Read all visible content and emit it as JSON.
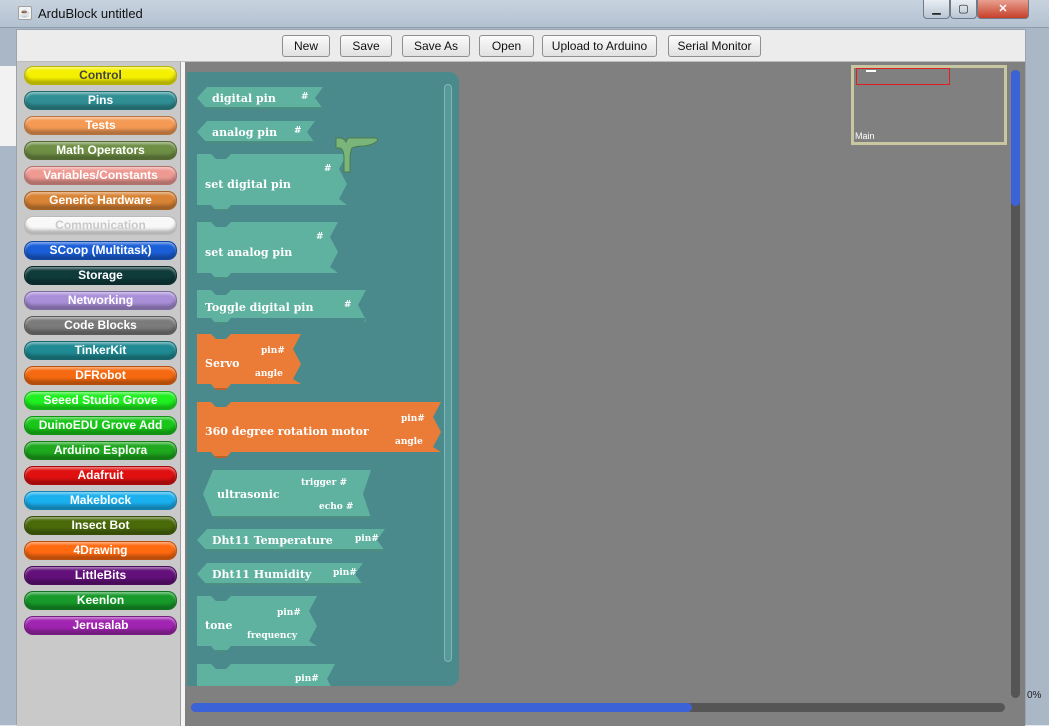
{
  "window": {
    "title": "ArduBlock untitled",
    "min": "▁",
    "max": "▢",
    "close": "✕",
    "app_icon": "☕"
  },
  "toolbar": {
    "new": "New",
    "save": "Save",
    "save_as": "Save As",
    "open": "Open",
    "upload": "Upload to Arduino",
    "serial": "Serial Monitor"
  },
  "categories": [
    {
      "label": "Control",
      "color": "#f5f000",
      "text": "#444"
    },
    {
      "label": "Pins",
      "color": "#2f8f95",
      "text": "#fff"
    },
    {
      "label": "Tests",
      "color": "#f59a55",
      "text": "#fff"
    },
    {
      "label": "Math Operators",
      "color": "#6f8f45",
      "text": "#fff"
    },
    {
      "label": "Variables/Constants",
      "color": "#ee9a93",
      "text": "#fff"
    },
    {
      "label": "Generic Hardware",
      "color": "#d98435",
      "text": "#fff"
    },
    {
      "label": "Communication",
      "color": "#f8f8f8",
      "text": "#c9c9c9"
    },
    {
      "label": "SCoop (Multitask)",
      "color": "#1a5fd8",
      "text": "#fff"
    },
    {
      "label": "Storage",
      "color": "#0f3b3b",
      "text": "#fff"
    },
    {
      "label": "Networking",
      "color": "#a98fd8",
      "text": "#fff"
    },
    {
      "label": "Code Blocks",
      "color": "#7b7b7b",
      "text": "#fff"
    },
    {
      "label": "TinkerKit",
      "color": "#1f8a93",
      "text": "#fff"
    },
    {
      "label": "DFRobot",
      "color": "#f56a10",
      "text": "#fff"
    },
    {
      "label": "Seeed Studio Grove",
      "color": "#1ff01f",
      "text": "#fff"
    },
    {
      "label": "DuinoEDU Grove Add",
      "color": "#19c719",
      "text": "#fff"
    },
    {
      "label": "Arduino Esplora",
      "color": "#1ea91e",
      "text": "#fff"
    },
    {
      "label": "Adafruit",
      "color": "#e01010",
      "text": "#fff"
    },
    {
      "label": "Makeblock",
      "color": "#1ab0ee",
      "text": "#fff"
    },
    {
      "label": "Insect Bot",
      "color": "#4a6a0a",
      "text": "#fff"
    },
    {
      "label": "4Drawing",
      "color": "#ff6a10",
      "text": "#fff"
    },
    {
      "label": "LittleBits",
      "color": "#63107a",
      "text": "#fff"
    },
    {
      "label": "Keenlon",
      "color": "#179a2a",
      "text": "#fff"
    },
    {
      "label": "Jerusalab",
      "color": "#a025b0",
      "text": "#fff"
    }
  ],
  "blocks": {
    "digital_pin": {
      "label": "digital pin",
      "socket": "#"
    },
    "analog_pin": {
      "label": "analog pin",
      "socket": "#"
    },
    "set_digital_pin": {
      "label": "set digital pin",
      "socket": "#"
    },
    "set_analog_pin": {
      "label": "set analog pin",
      "socket": "#"
    },
    "toggle_digital_pin": {
      "label": "Toggle digital pin",
      "socket": "#"
    },
    "servo": {
      "label": "Servo",
      "socket1": "pin#",
      "socket2": "angle"
    },
    "rotation_motor": {
      "label": "360 degree rotation motor",
      "socket1": "pin#",
      "socket2": "angle"
    },
    "ultrasonic": {
      "label": "ultrasonic",
      "socket1": "trigger #",
      "socket2": "echo #"
    },
    "dht11_temperature": {
      "label": "Dht11 Temperature",
      "socket": "pin#"
    },
    "dht11_humidity": {
      "label": "Dht11 Humidity",
      "socket": "pin#"
    },
    "tone": {
      "label": "tone",
      "socket1": "pin#",
      "socket2": "frequency"
    },
    "partial": {
      "socket": "pin#"
    }
  },
  "minimap": {
    "label": "Main"
  },
  "background": {
    "right_text": "0%"
  }
}
